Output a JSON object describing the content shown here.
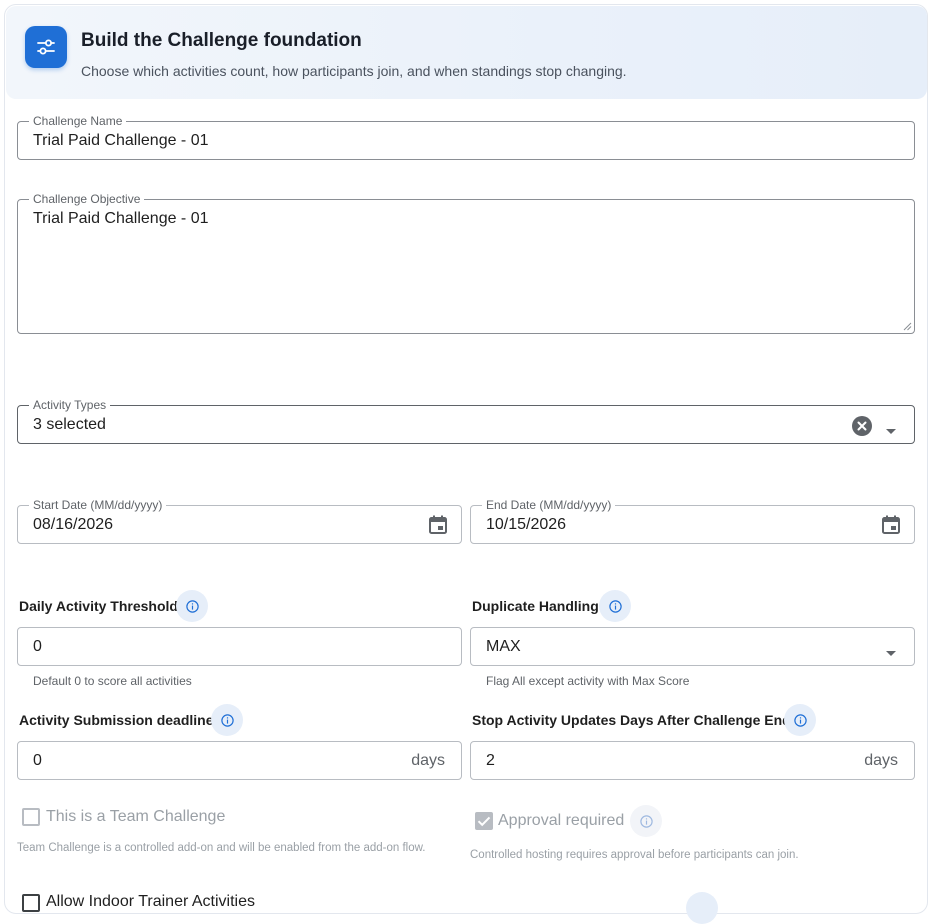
{
  "header": {
    "icon": "sliders-icon",
    "title": "Build the Challenge foundation",
    "subtitle": "Choose which activities count, how participants join, and when standings stop changing."
  },
  "challenge_name": {
    "label": "Challenge Name",
    "value": "Trial Paid Challenge - 01"
  },
  "challenge_objective": {
    "label": "Challenge Objective",
    "value": "Trial Paid Challenge - 01"
  },
  "activity_types": {
    "label": "Activity Types",
    "value": "3 selected"
  },
  "start_date": {
    "label": "Start Date (MM/dd/yyyy)",
    "value": "08/16/2026"
  },
  "end_date": {
    "label": "End Date (MM/dd/yyyy)",
    "value": "10/15/2026"
  },
  "daily_threshold": {
    "label": "Daily Activity Threshold",
    "value": "0",
    "helper": "Default 0 to score all activities"
  },
  "duplicate_handling": {
    "label": "Duplicate Handling",
    "value": "MAX",
    "helper": "Flag All except activity with Max Score"
  },
  "submission_deadline": {
    "label": "Activity Submission deadline",
    "value": "0",
    "suffix": "days"
  },
  "stop_updates": {
    "label": "Stop Activity Updates Days After Challenge End",
    "value": "2",
    "suffix": "days"
  },
  "team_challenge": {
    "label": "This is a Team Challenge",
    "checked": false,
    "helper": "Team Challenge is a controlled add-on and will be enabled from the add-on flow."
  },
  "approval_required": {
    "label": "Approval required",
    "checked": true,
    "helper": "Controlled hosting requires approval before participants can join."
  },
  "indoor_trainer": {
    "label": "Allow Indoor Trainer Activities",
    "checked": false
  },
  "colors": {
    "accent": "#1f6fd6",
    "info_bg": "#e6eef9"
  }
}
